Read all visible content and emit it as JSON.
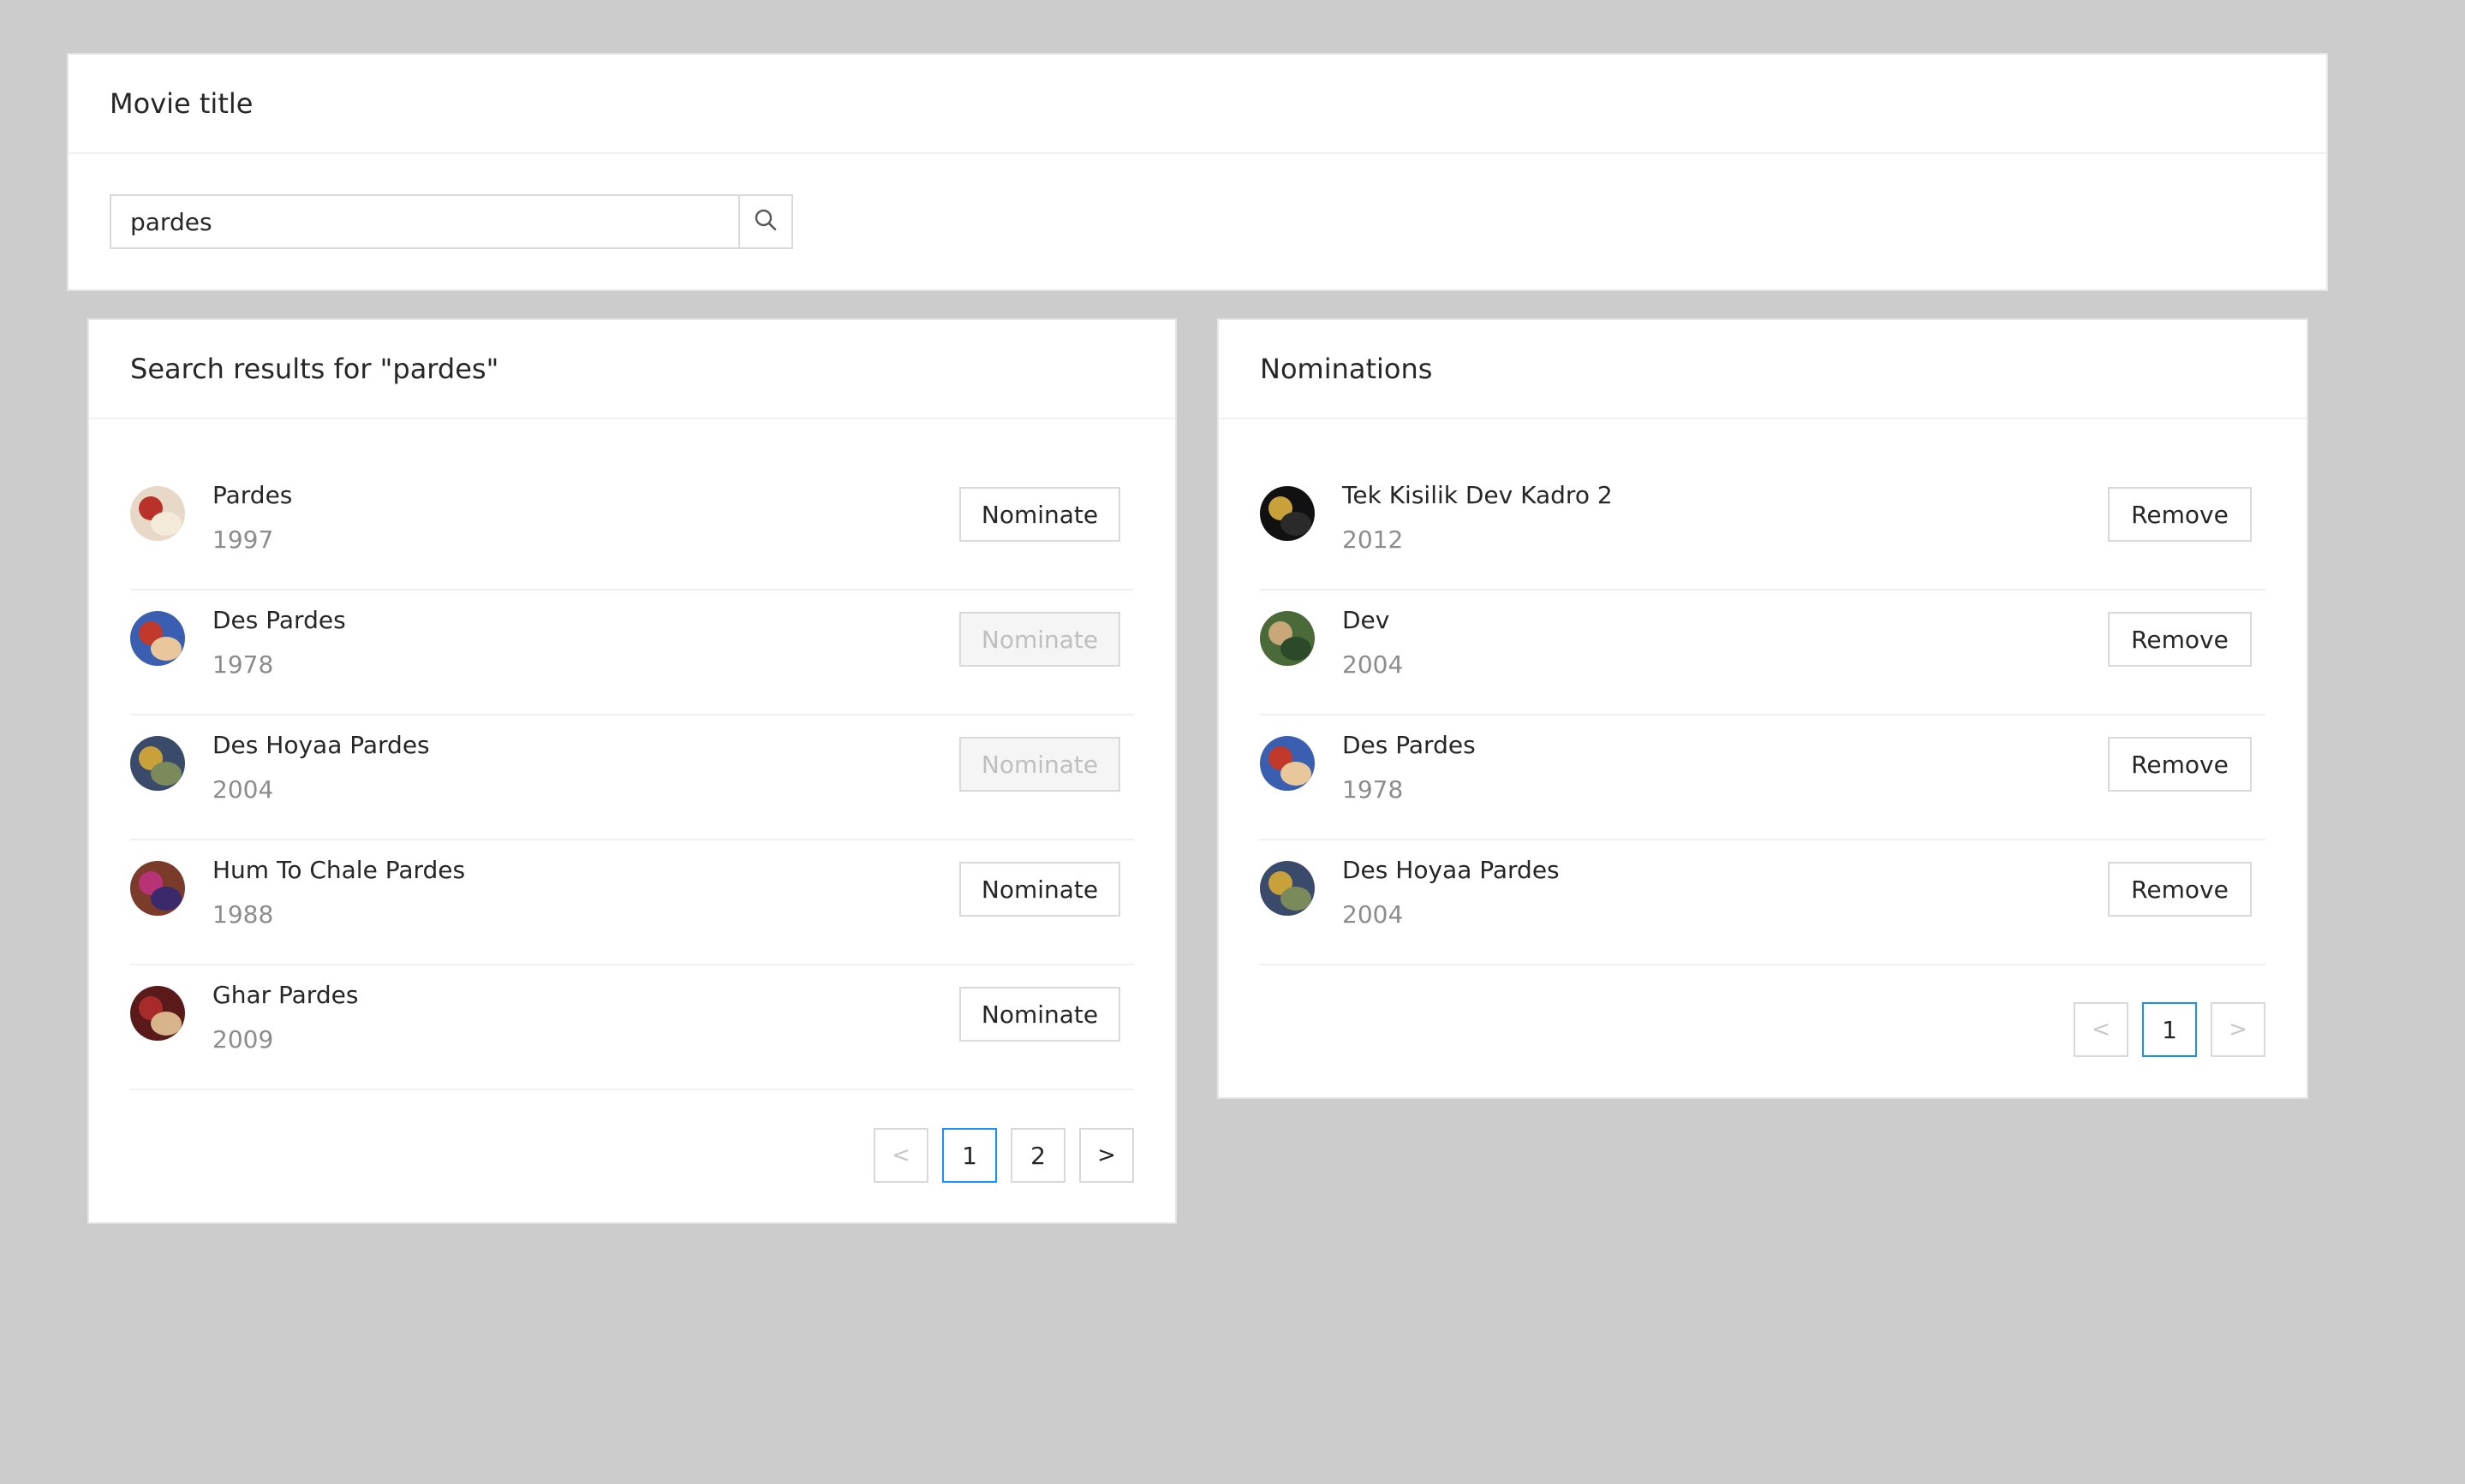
{
  "search": {
    "heading": "Movie title",
    "value": "pardes",
    "icon": "search-icon"
  },
  "results": {
    "heading": "Search results for \"pardes\"",
    "items": [
      {
        "title": "Pardes",
        "year": "1997",
        "action": "Nominate",
        "disabled": false,
        "poster_colors": [
          "#e8d8c8",
          "#b8322a",
          "#f3ead9"
        ]
      },
      {
        "title": "Des Pardes",
        "year": "1978",
        "action": "Nominate",
        "disabled": true,
        "poster_colors": [
          "#3b5fb0",
          "#c0392b",
          "#e8c79a"
        ]
      },
      {
        "title": "Des Hoyaa Pardes",
        "year": "2004",
        "action": "Nominate",
        "disabled": true,
        "poster_colors": [
          "#3a4a6b",
          "#c9a13b",
          "#7a8a5a"
        ]
      },
      {
        "title": "Hum To Chale Pardes",
        "year": "1988",
        "action": "Nominate",
        "disabled": false,
        "poster_colors": [
          "#7a3b2a",
          "#b83276",
          "#3b2a6b"
        ]
      },
      {
        "title": "Ghar Pardes",
        "year": "2009",
        "action": "Nominate",
        "disabled": false,
        "poster_colors": [
          "#5a1a1a",
          "#a82b2b",
          "#d8b48a"
        ]
      }
    ],
    "pagination": {
      "prev": "<",
      "pages": [
        "1",
        "2"
      ],
      "active": "1",
      "next": ">"
    }
  },
  "nominations": {
    "heading": "Nominations",
    "items": [
      {
        "title": "Tek Kisilik Dev Kadro 2",
        "year": "2012",
        "action": "Remove",
        "poster_colors": [
          "#111111",
          "#c9a13b",
          "#2a2a2a"
        ]
      },
      {
        "title": "Dev",
        "year": "2004",
        "action": "Remove",
        "poster_colors": [
          "#4a6a3a",
          "#c8a878",
          "#2a4a2a"
        ]
      },
      {
        "title": "Des Pardes",
        "year": "1978",
        "action": "Remove",
        "poster_colors": [
          "#3b5fb0",
          "#c0392b",
          "#e8c79a"
        ]
      },
      {
        "title": "Des Hoyaa Pardes",
        "year": "2004",
        "action": "Remove",
        "poster_colors": [
          "#3a4a6b",
          "#c9a13b",
          "#7a8a5a"
        ]
      }
    ],
    "pagination": {
      "prev": "<",
      "pages": [
        "1"
      ],
      "active": "1",
      "next": ">"
    }
  },
  "colors": {
    "background": "#cccccc",
    "card": "#ffffff",
    "border": "#d9d9d9",
    "active_page": "#1890ff",
    "muted_text": "#8c8c8c",
    "disabled_bg": "#f5f5f5",
    "disabled_text": "#bfbfbf"
  }
}
